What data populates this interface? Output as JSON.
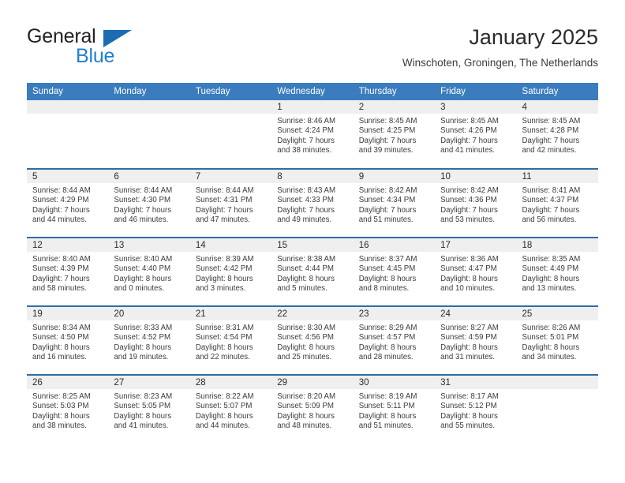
{
  "brand": {
    "name_part1": "General",
    "name_part2": "Blue",
    "logo_icon": "triangle-flag-icon",
    "accent_color": "#1f7fd4"
  },
  "header": {
    "title": "January 2025",
    "subtitle": "Winschoten, Groningen, The Netherlands"
  },
  "calendar": {
    "header_bg": "#3a7cbe",
    "daynum_bg": "#efefef",
    "row_border_color": "#2f6ca8",
    "weekday_headers": [
      "Sunday",
      "Monday",
      "Tuesday",
      "Wednesday",
      "Thursday",
      "Friday",
      "Saturday"
    ],
    "weeks": [
      [
        {
          "day": "",
          "empty": true,
          "sunrise": "",
          "sunset": "",
          "daylight_line1": "",
          "daylight_line2": ""
        },
        {
          "day": "",
          "empty": true,
          "sunrise": "",
          "sunset": "",
          "daylight_line1": "",
          "daylight_line2": ""
        },
        {
          "day": "",
          "empty": true,
          "sunrise": "",
          "sunset": "",
          "daylight_line1": "",
          "daylight_line2": ""
        },
        {
          "day": "1",
          "empty": false,
          "sunrise": "Sunrise: 8:46 AM",
          "sunset": "Sunset: 4:24 PM",
          "daylight_line1": "Daylight: 7 hours",
          "daylight_line2": "and 38 minutes."
        },
        {
          "day": "2",
          "empty": false,
          "sunrise": "Sunrise: 8:45 AM",
          "sunset": "Sunset: 4:25 PM",
          "daylight_line1": "Daylight: 7 hours",
          "daylight_line2": "and 39 minutes."
        },
        {
          "day": "3",
          "empty": false,
          "sunrise": "Sunrise: 8:45 AM",
          "sunset": "Sunset: 4:26 PM",
          "daylight_line1": "Daylight: 7 hours",
          "daylight_line2": "and 41 minutes."
        },
        {
          "day": "4",
          "empty": false,
          "sunrise": "Sunrise: 8:45 AM",
          "sunset": "Sunset: 4:28 PM",
          "daylight_line1": "Daylight: 7 hours",
          "daylight_line2": "and 42 minutes."
        }
      ],
      [
        {
          "day": "5",
          "empty": false,
          "sunrise": "Sunrise: 8:44 AM",
          "sunset": "Sunset: 4:29 PM",
          "daylight_line1": "Daylight: 7 hours",
          "daylight_line2": "and 44 minutes."
        },
        {
          "day": "6",
          "empty": false,
          "sunrise": "Sunrise: 8:44 AM",
          "sunset": "Sunset: 4:30 PM",
          "daylight_line1": "Daylight: 7 hours",
          "daylight_line2": "and 46 minutes."
        },
        {
          "day": "7",
          "empty": false,
          "sunrise": "Sunrise: 8:44 AM",
          "sunset": "Sunset: 4:31 PM",
          "daylight_line1": "Daylight: 7 hours",
          "daylight_line2": "and 47 minutes."
        },
        {
          "day": "8",
          "empty": false,
          "sunrise": "Sunrise: 8:43 AM",
          "sunset": "Sunset: 4:33 PM",
          "daylight_line1": "Daylight: 7 hours",
          "daylight_line2": "and 49 minutes."
        },
        {
          "day": "9",
          "empty": false,
          "sunrise": "Sunrise: 8:42 AM",
          "sunset": "Sunset: 4:34 PM",
          "daylight_line1": "Daylight: 7 hours",
          "daylight_line2": "and 51 minutes."
        },
        {
          "day": "10",
          "empty": false,
          "sunrise": "Sunrise: 8:42 AM",
          "sunset": "Sunset: 4:36 PM",
          "daylight_line1": "Daylight: 7 hours",
          "daylight_line2": "and 53 minutes."
        },
        {
          "day": "11",
          "empty": false,
          "sunrise": "Sunrise: 8:41 AM",
          "sunset": "Sunset: 4:37 PM",
          "daylight_line1": "Daylight: 7 hours",
          "daylight_line2": "and 56 minutes."
        }
      ],
      [
        {
          "day": "12",
          "empty": false,
          "sunrise": "Sunrise: 8:40 AM",
          "sunset": "Sunset: 4:39 PM",
          "daylight_line1": "Daylight: 7 hours",
          "daylight_line2": "and 58 minutes."
        },
        {
          "day": "13",
          "empty": false,
          "sunrise": "Sunrise: 8:40 AM",
          "sunset": "Sunset: 4:40 PM",
          "daylight_line1": "Daylight: 8 hours",
          "daylight_line2": "and 0 minutes."
        },
        {
          "day": "14",
          "empty": false,
          "sunrise": "Sunrise: 8:39 AM",
          "sunset": "Sunset: 4:42 PM",
          "daylight_line1": "Daylight: 8 hours",
          "daylight_line2": "and 3 minutes."
        },
        {
          "day": "15",
          "empty": false,
          "sunrise": "Sunrise: 8:38 AM",
          "sunset": "Sunset: 4:44 PM",
          "daylight_line1": "Daylight: 8 hours",
          "daylight_line2": "and 5 minutes."
        },
        {
          "day": "16",
          "empty": false,
          "sunrise": "Sunrise: 8:37 AM",
          "sunset": "Sunset: 4:45 PM",
          "daylight_line1": "Daylight: 8 hours",
          "daylight_line2": "and 8 minutes."
        },
        {
          "day": "17",
          "empty": false,
          "sunrise": "Sunrise: 8:36 AM",
          "sunset": "Sunset: 4:47 PM",
          "daylight_line1": "Daylight: 8 hours",
          "daylight_line2": "and 10 minutes."
        },
        {
          "day": "18",
          "empty": false,
          "sunrise": "Sunrise: 8:35 AM",
          "sunset": "Sunset: 4:49 PM",
          "daylight_line1": "Daylight: 8 hours",
          "daylight_line2": "and 13 minutes."
        }
      ],
      [
        {
          "day": "19",
          "empty": false,
          "sunrise": "Sunrise: 8:34 AM",
          "sunset": "Sunset: 4:50 PM",
          "daylight_line1": "Daylight: 8 hours",
          "daylight_line2": "and 16 minutes."
        },
        {
          "day": "20",
          "empty": false,
          "sunrise": "Sunrise: 8:33 AM",
          "sunset": "Sunset: 4:52 PM",
          "daylight_line1": "Daylight: 8 hours",
          "daylight_line2": "and 19 minutes."
        },
        {
          "day": "21",
          "empty": false,
          "sunrise": "Sunrise: 8:31 AM",
          "sunset": "Sunset: 4:54 PM",
          "daylight_line1": "Daylight: 8 hours",
          "daylight_line2": "and 22 minutes."
        },
        {
          "day": "22",
          "empty": false,
          "sunrise": "Sunrise: 8:30 AM",
          "sunset": "Sunset: 4:56 PM",
          "daylight_line1": "Daylight: 8 hours",
          "daylight_line2": "and 25 minutes."
        },
        {
          "day": "23",
          "empty": false,
          "sunrise": "Sunrise: 8:29 AM",
          "sunset": "Sunset: 4:57 PM",
          "daylight_line1": "Daylight: 8 hours",
          "daylight_line2": "and 28 minutes."
        },
        {
          "day": "24",
          "empty": false,
          "sunrise": "Sunrise: 8:27 AM",
          "sunset": "Sunset: 4:59 PM",
          "daylight_line1": "Daylight: 8 hours",
          "daylight_line2": "and 31 minutes."
        },
        {
          "day": "25",
          "empty": false,
          "sunrise": "Sunrise: 8:26 AM",
          "sunset": "Sunset: 5:01 PM",
          "daylight_line1": "Daylight: 8 hours",
          "daylight_line2": "and 34 minutes."
        }
      ],
      [
        {
          "day": "26",
          "empty": false,
          "sunrise": "Sunrise: 8:25 AM",
          "sunset": "Sunset: 5:03 PM",
          "daylight_line1": "Daylight: 8 hours",
          "daylight_line2": "and 38 minutes."
        },
        {
          "day": "27",
          "empty": false,
          "sunrise": "Sunrise: 8:23 AM",
          "sunset": "Sunset: 5:05 PM",
          "daylight_line1": "Daylight: 8 hours",
          "daylight_line2": "and 41 minutes."
        },
        {
          "day": "28",
          "empty": false,
          "sunrise": "Sunrise: 8:22 AM",
          "sunset": "Sunset: 5:07 PM",
          "daylight_line1": "Daylight: 8 hours",
          "daylight_line2": "and 44 minutes."
        },
        {
          "day": "29",
          "empty": false,
          "sunrise": "Sunrise: 8:20 AM",
          "sunset": "Sunset: 5:09 PM",
          "daylight_line1": "Daylight: 8 hours",
          "daylight_line2": "and 48 minutes."
        },
        {
          "day": "30",
          "empty": false,
          "sunrise": "Sunrise: 8:19 AM",
          "sunset": "Sunset: 5:11 PM",
          "daylight_line1": "Daylight: 8 hours",
          "daylight_line2": "and 51 minutes."
        },
        {
          "day": "31",
          "empty": false,
          "sunrise": "Sunrise: 8:17 AM",
          "sunset": "Sunset: 5:12 PM",
          "daylight_line1": "Daylight: 8 hours",
          "daylight_line2": "and 55 minutes."
        },
        {
          "day": "",
          "empty": true,
          "sunrise": "",
          "sunset": "",
          "daylight_line1": "",
          "daylight_line2": ""
        }
      ]
    ]
  }
}
